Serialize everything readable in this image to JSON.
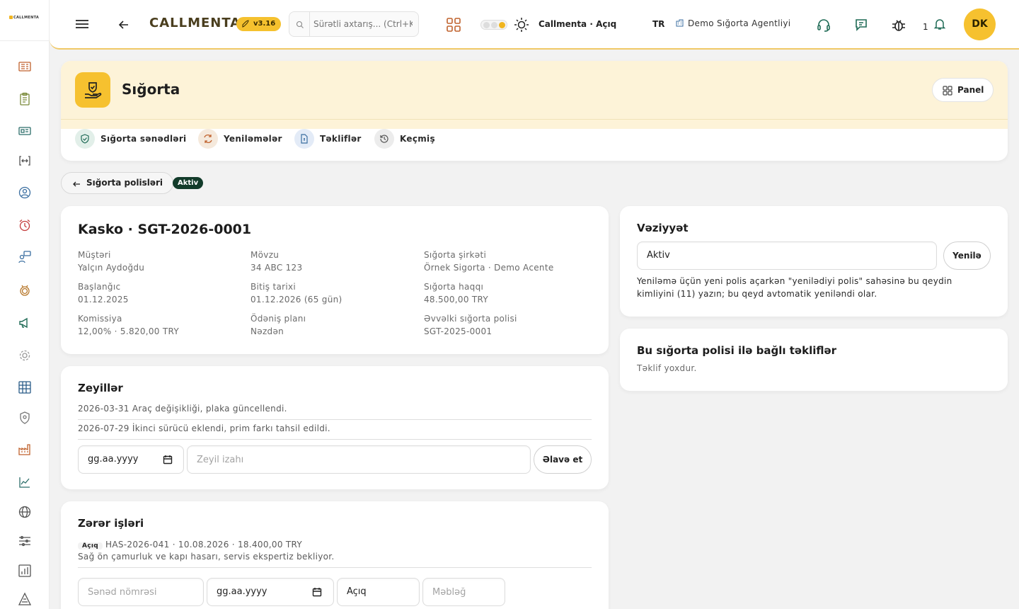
{
  "sidebar": {
    "logo": "CALLMENTA",
    "icons": [
      "ticket-list-icon",
      "clipboard-icon",
      "id-card-icon",
      "code-brackets-icon",
      "headset-user-icon",
      "alarm-clock-icon",
      "chat-users-icon",
      "medal-icon",
      "megaphone-icon",
      "gear-icon",
      "grid-board-icon",
      "shield-icon",
      "factory-icon",
      "line-chart-icon",
      "globe-icon",
      "sliders-icon",
      "bar-chart-icon",
      "triangle-warning-icon"
    ]
  },
  "topbar": {
    "brand": "CALLMENTA",
    "version": "v3.16",
    "search_placeholder": "Sürətli axtarış... (Ctrl+K)",
    "status": "Callmenta · Açıq",
    "language": "TR",
    "agency": "Demo Sığorta Agentliyi",
    "notification_count": "1",
    "user_initials": "DK"
  },
  "header": {
    "title": "Sığorta",
    "panel_label": "Panel",
    "tabs": [
      {
        "label": "Sığorta sənədləri"
      },
      {
        "label": "Yeniləmələr"
      },
      {
        "label": "Təkliflər"
      },
      {
        "label": "Keçmiş"
      }
    ]
  },
  "breadcrumb": {
    "back_label": "Sığorta polisləri",
    "status_badge": "Aktiv"
  },
  "policy": {
    "title": "Kasko · SGT-2026-0001",
    "fields": [
      {
        "label": "Müştəri",
        "value": "Yalçın Aydoğdu"
      },
      {
        "label": "Mövzu",
        "value": "34 ABC 123"
      },
      {
        "label": "Sığorta şirkəti",
        "value": "Örnek Sigorta · Demo Acente"
      },
      {
        "label": "Başlanğıc",
        "value": "01.12.2025"
      },
      {
        "label": "Bitiş tarixi",
        "value": "01.12.2026 (65 gün)"
      },
      {
        "label": "Sığorta haqqı",
        "value": "48.500,00 TRY"
      },
      {
        "label": "Komissiya",
        "value": "12,00% · 5.820,00 TRY"
      },
      {
        "label": "Ödəniş planı",
        "value": "Nəzdən"
      },
      {
        "label": "Əvvəlki sığorta polisi",
        "value": "SGT-2025-0001"
      }
    ]
  },
  "endorsements": {
    "title": "Zeyillər",
    "items": [
      "2026-03-31 Araç değişikliği, plaka güncellendi.",
      "2026-07-29 İkinci sürücü eklendi, prim farkı tahsil edildi."
    ],
    "date_placeholder": "gg.aa.yyyy",
    "note_placeholder": "Zeyil izahı",
    "add_label": "Əlavə et"
  },
  "claims": {
    "title": "Zərər işləri",
    "items": [
      {
        "status": "Açıq",
        "summary": "HAS-2026-041 · 10.08.2026 · 18.400,00 TRY",
        "description": "Sağ ön çamurluk ve kapı hasarı, servis ekspertiz bekliyor."
      }
    ],
    "doc_placeholder": "Sənəd nömrəsi",
    "date_placeholder": "gg.aa.yyyy",
    "status_value": "Açıq",
    "amount_placeholder": "Məbləğ"
  },
  "state": {
    "title": "Vəziyyət",
    "value": "Aktiv",
    "renew_label": "Yenilə",
    "hint": "Yeniləmə üçün yeni polis açarkən \"yenilədiyi polis\" sahəsinə bu qeydin kimliyini (11) yazın; bu qeyd avtomatik yeniləndi olar."
  },
  "offers": {
    "title": "Bu sığorta polisi ilə bağlı təkliflər",
    "empty": "Təklif yoxdur."
  },
  "colors": {
    "accent": "#f6c12f",
    "header_bg": "#fdf3d8",
    "badge": "#123b2a"
  }
}
